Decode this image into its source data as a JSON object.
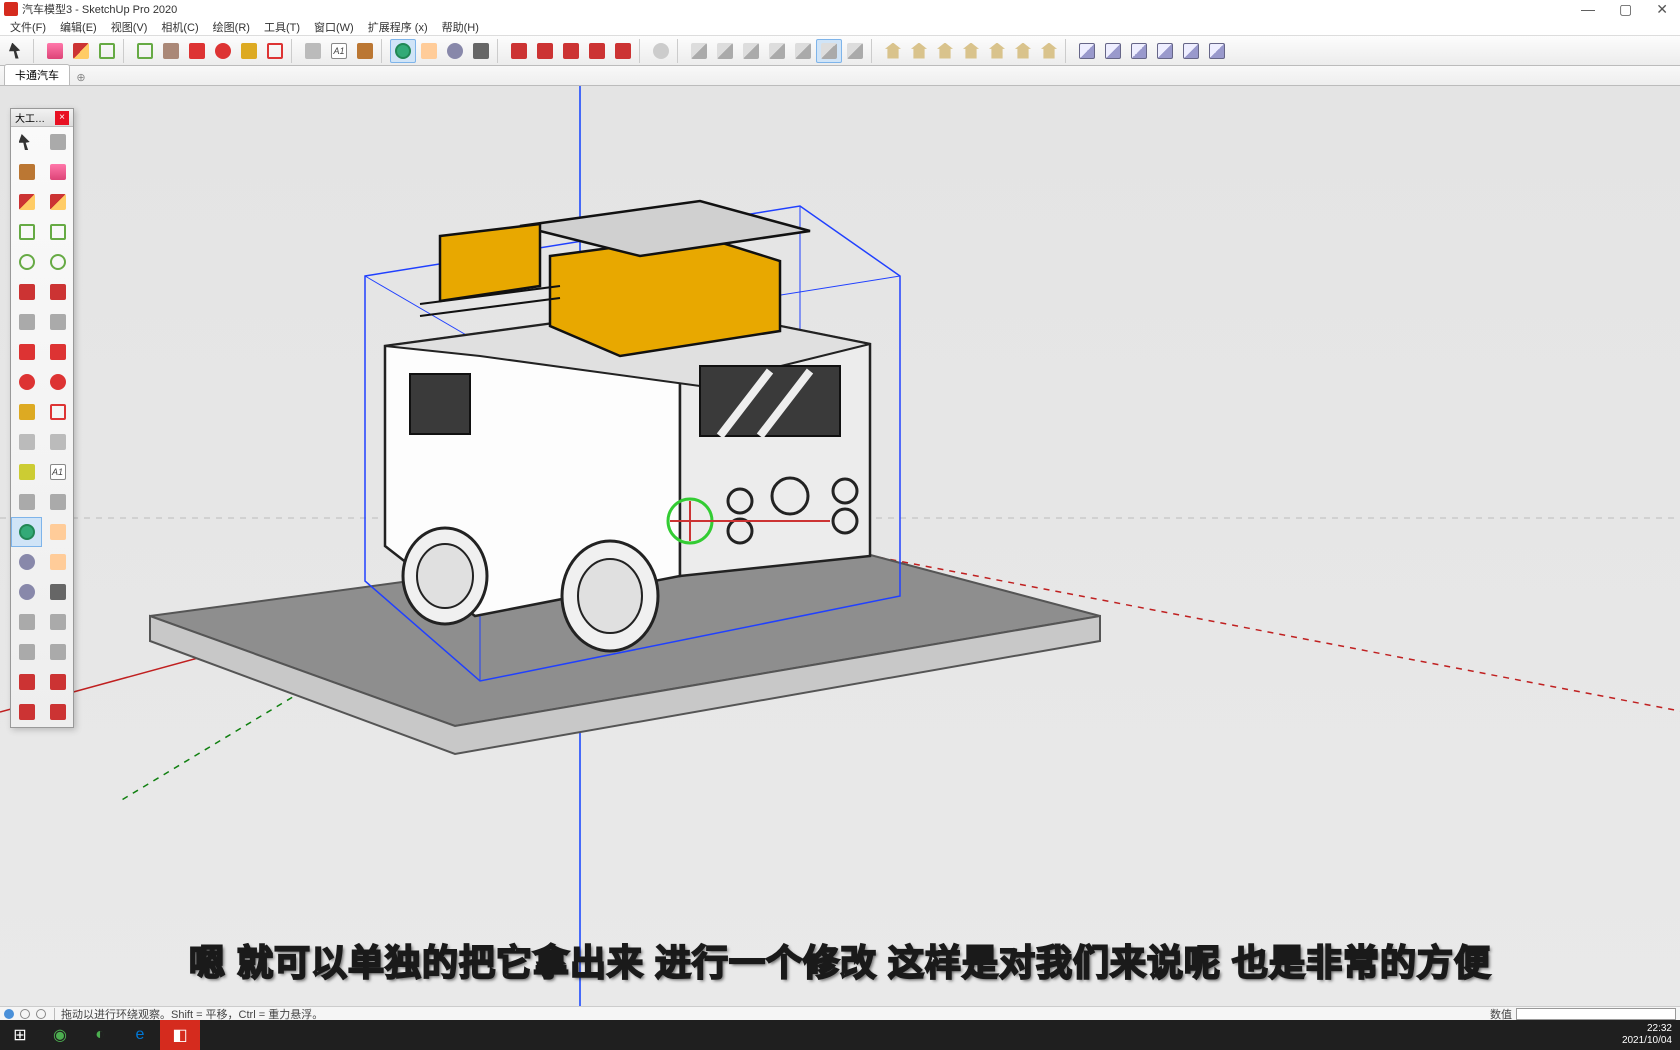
{
  "title_bar": {
    "title": "汽车模型3 - SketchUp Pro 2020"
  },
  "menu": {
    "items": [
      "文件(F)",
      "编辑(E)",
      "视图(V)",
      "相机(C)",
      "绘图(R)",
      "工具(T)",
      "窗口(W)",
      "扩展程序 (x)",
      "帮助(H)"
    ]
  },
  "tabs": {
    "active": "卡通汽车"
  },
  "tool_panel": {
    "title": "大工…"
  },
  "status": {
    "message": "拖动以进行环绕观察。Shift = 平移，Ctrl = 重力悬浮。",
    "vcb_label": "数值"
  },
  "subtitle": "嗯 就可以单独的把它拿出来 进行一个修改 这样是对我们来说呢 也是非常的方便",
  "taskbar": {
    "time": "22:32",
    "date": "2021/10/04"
  },
  "toolbar_groups": [
    [
      "select",
      "eraser",
      "pencil",
      "rect"
    ],
    [
      "rect2",
      "push",
      "move",
      "rot",
      "scale",
      "offset"
    ],
    [
      "tape",
      "text",
      "paint"
    ],
    [
      "orbit",
      "pan",
      "zoom",
      "zoom-ext"
    ],
    [
      "red",
      "red",
      "red",
      "red",
      "red"
    ],
    [
      "face"
    ],
    [
      "cube",
      "cube",
      "cube",
      "cube",
      "cube",
      "cube-active",
      "cube"
    ],
    [
      "house",
      "house",
      "house",
      "house",
      "house",
      "house",
      "house"
    ],
    [
      "cube2",
      "cube2",
      "cube2",
      "cube2",
      "cube2",
      "cube2"
    ]
  ],
  "tool_panel_items": [
    [
      "select",
      "gray"
    ],
    [
      "paint",
      "eraser"
    ],
    [
      "pencil",
      "pencil"
    ],
    [
      "rect",
      "rect"
    ],
    [
      "circ",
      "circ"
    ],
    [
      "red",
      "red"
    ],
    [
      "gray",
      "gray"
    ],
    [
      "move",
      "move"
    ],
    [
      "rot",
      "rot"
    ],
    [
      "scale",
      "offset"
    ],
    [
      "tape",
      "tape"
    ],
    [
      "dim",
      "text"
    ],
    [
      "gray",
      "gray"
    ],
    [
      "orbit-active",
      "pan"
    ],
    [
      "zoom",
      "pan"
    ],
    [
      "zoom",
      "ext"
    ],
    [
      "gray",
      "gray"
    ],
    [
      "gray",
      "gray"
    ],
    [
      "red",
      "red"
    ],
    [
      "red",
      "red"
    ]
  ]
}
